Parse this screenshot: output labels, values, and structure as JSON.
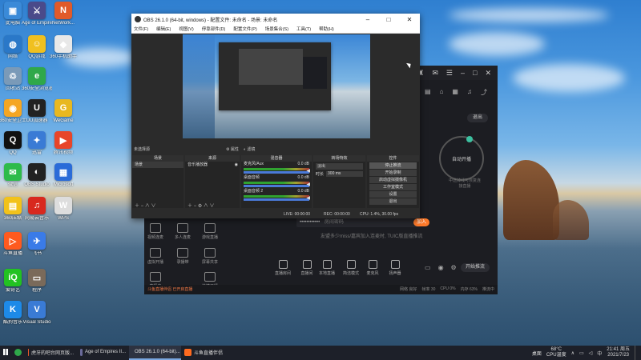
{
  "desktop": {
    "icons": [
      {
        "label": "此电脑",
        "color": "#3a8ad8",
        "glyph": "▣",
        "col": 0,
        "row": 0
      },
      {
        "label": "Age of Empire...",
        "color": "#4a4a8a",
        "glyph": "⚔",
        "col": 1,
        "row": 0
      },
      {
        "label": "NetWork...",
        "color": "#e05a2a",
        "glyph": "N",
        "col": 2,
        "row": 0
      },
      {
        "label": "网络",
        "color": "#2a78c8",
        "glyph": "◍",
        "col": 0,
        "row": 1
      },
      {
        "label": "QQ游戏",
        "color": "#f0c020",
        "glyph": "☺",
        "col": 1,
        "row": 1
      },
      {
        "label": "360手机助手",
        "color": "#e8e8e8",
        "glyph": "◆",
        "col": 2,
        "row": 1
      },
      {
        "label": "回收站",
        "color": "#7a9ab8",
        "glyph": "♲",
        "col": 0,
        "row": 2
      },
      {
        "label": "360安全浏览器",
        "color": "#2fa84a",
        "glyph": "e",
        "col": 1,
        "row": 2
      },
      {
        "label": "360安全卫士",
        "color": "#f5a623",
        "glyph": "◉",
        "col": 0,
        "row": 3
      },
      {
        "label": "UU加速器",
        "color": "#222",
        "glyph": "U",
        "col": 1,
        "row": 3
      },
      {
        "label": "WeGame",
        "color": "#e8b820",
        "glyph": "G",
        "col": 2,
        "row": 3
      },
      {
        "label": "QQ",
        "color": "#111",
        "glyph": "Q",
        "col": 0,
        "row": 4
      },
      {
        "label": "迅雷",
        "color": "#3a7bd5",
        "glyph": "✦",
        "col": 1,
        "row": 4
      },
      {
        "label": "腾讯视频",
        "color": "#e8452a",
        "glyph": "▶",
        "col": 2,
        "row": 4
      },
      {
        "label": "微信",
        "color": "#2dbb4a",
        "glyph": "✉",
        "col": 0,
        "row": 5
      },
      {
        "label": "OBS Studio",
        "color": "#222",
        "glyph": "◐",
        "col": 1,
        "row": 5
      },
      {
        "label": "Microsoft",
        "color": "#2a6bd8",
        "glyph": "▦",
        "col": 2,
        "row": 5
      },
      {
        "label": "360压缩",
        "color": "#f2c21a",
        "glyph": "▤",
        "col": 0,
        "row": 6
      },
      {
        "label": "网易云音乐",
        "color": "#d8281e",
        "glyph": "♫",
        "col": 1,
        "row": 6
      },
      {
        "label": "WPS",
        "color": "#ddd",
        "glyph": "W",
        "col": 2,
        "row": 6
      },
      {
        "label": "斗鱼直播",
        "color": "#ff5a1f",
        "glyph": "▷",
        "col": 0,
        "row": 7
      },
      {
        "label": "飞书",
        "color": "#3a7be8",
        "glyph": "✈",
        "col": 1,
        "row": 7
      },
      {
        "label": "爱奇艺",
        "color": "#22c222",
        "glyph": "iQ",
        "col": 0,
        "row": 8
      },
      {
        "label": "程序",
        "color": "#7a6a5a",
        "glyph": "▭",
        "col": 1,
        "row": 8
      },
      {
        "label": "酷狗音乐",
        "color": "#1d8ae8",
        "glyph": "K",
        "col": 0,
        "row": 9
      },
      {
        "label": "Visual Studio",
        "color": "#3a7bd5",
        "glyph": "V",
        "col": 1,
        "row": 9
      }
    ]
  },
  "obs": {
    "title": "OBS 26.1.0 (64-bit, windows) - 配置文件: 未命名 - 场景: 未命名",
    "menu": [
      "文件(F)",
      "编辑(E)",
      "视图(V)",
      "停靠部件(D)",
      "配置文件(P)",
      "场景集合(S)",
      "工具(T)",
      "帮助(H)"
    ],
    "source_select_label": "未选择源",
    "props_label": "属性",
    "filters_label": "滤镜",
    "docks": {
      "scenes": {
        "title": "场景",
        "items": [
          "场景"
        ]
      },
      "sources": {
        "title": "来源",
        "items": [
          "音乐播放器"
        ]
      },
      "mixer": {
        "title": "混音器",
        "channels": [
          {
            "name": "麦克风/Aux",
            "db": "0.0 dB"
          },
          {
            "name": "桌面音频",
            "db": "0.0 dB"
          },
          {
            "name": "桌面音频 2",
            "db": "0.0 dB"
          }
        ]
      },
      "transitions": {
        "title": "转场特效",
        "type": "淡出",
        "duration_label": "时长",
        "duration_value": "300 ms"
      },
      "controls": {
        "title": "控件",
        "buttons": [
          "停止推流",
          "开始录制",
          "启动虚拟摄像机",
          "工作室模式",
          "设置",
          "退出"
        ]
      }
    },
    "status": {
      "live": "LIVE: 00:00:00",
      "rec": "REC: 00:00:00",
      "cpu": "CPU: 1.4%, 30.00 fps"
    }
  },
  "app": {
    "auto_open": "自动开播",
    "exit_btn": "退出",
    "ring_hint": "中途掉线可恢复连\n接直播",
    "password_placeholder": "房间密码",
    "join_label": "加入",
    "sub_hint": "友盟多少miss/嘉宾加入连麦时, TUIC版直播推流",
    "tiles": [
      "视频连麦",
      "多人连麦",
      "游戏直播",
      "虚拟开播",
      "录播带",
      "屏幕共享",
      "直播中",
      "快捷开播"
    ],
    "tools": [
      "直播房间",
      "直播间",
      "本地直播",
      "简洁模式",
      "麦克风",
      "扬声器"
    ],
    "start_btn": "开始推流",
    "notice": "斗鱼直播伴侣 已开启直播",
    "status_right": [
      "网络 良好",
      "帧率 30",
      "CPU 0%",
      "内存 63%",
      "推流中"
    ]
  },
  "taskbar": {
    "items": [
      {
        "label": "虎牙的吧台网页版...",
        "color": "#e85a2a",
        "active": false
      },
      {
        "label": "Age of Empires II...",
        "color": "#6a6a9a",
        "active": false
      },
      {
        "label": "OBS 26.1.0 (64-bit)...",
        "color": "#444",
        "active": true
      },
      {
        "label": "斗鱼直播伴侣",
        "color": "#ff6a1f",
        "active": false
      }
    ],
    "weather_temp": "68°C",
    "weather_label": "CPU温度",
    "time": "21:41",
    "date": "2021/7/23",
    "weekday": "周五",
    "tray_text": "桌面"
  }
}
